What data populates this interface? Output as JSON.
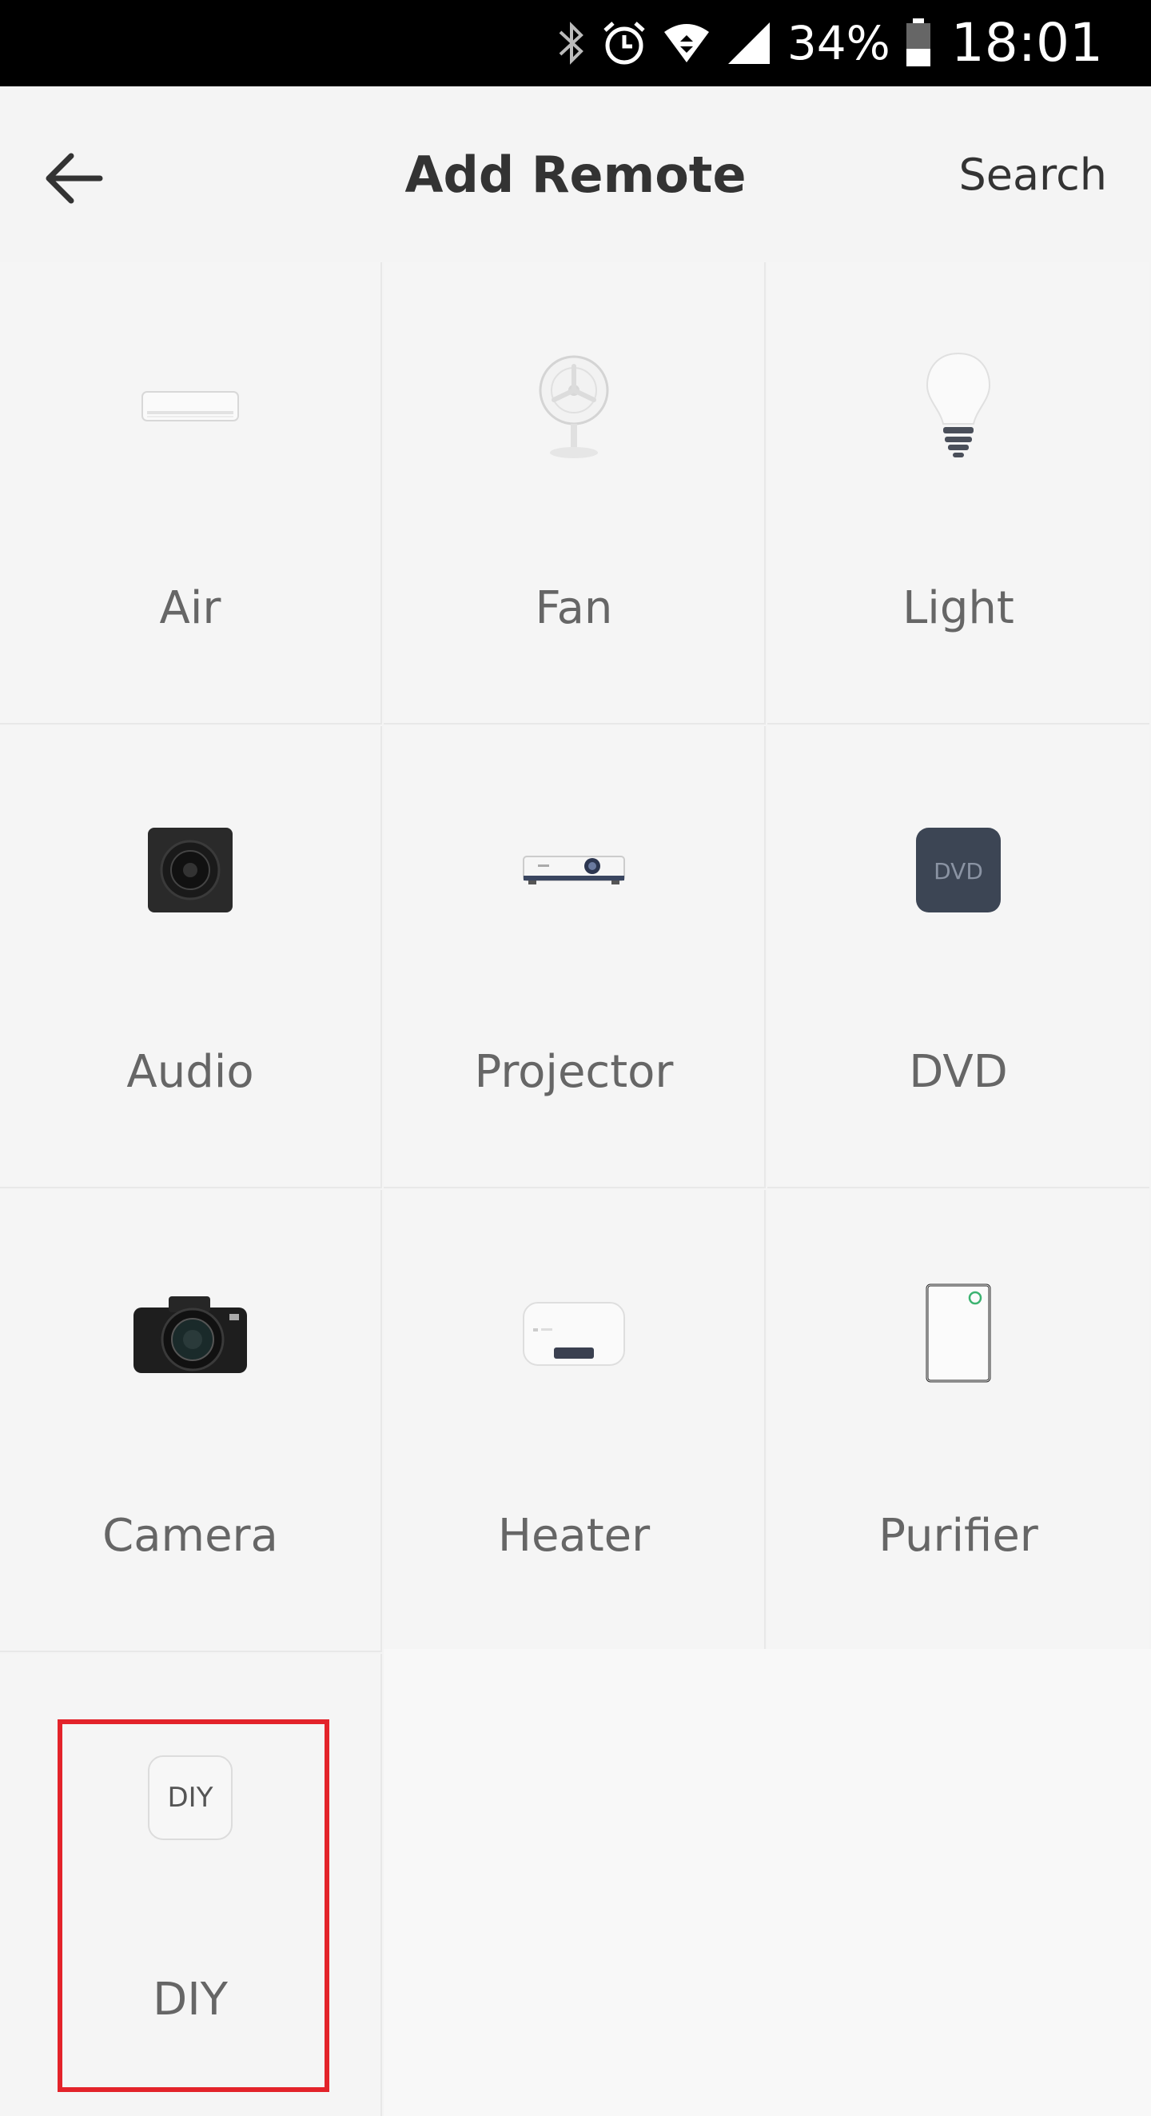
{
  "status_bar": {
    "battery": "34%",
    "time": "18:01"
  },
  "header": {
    "title": "Add Remote",
    "search_label": "Search"
  },
  "devices": [
    {
      "label": "Air",
      "icon": "air-conditioner-icon"
    },
    {
      "label": "Fan",
      "icon": "fan-icon"
    },
    {
      "label": "Light",
      "icon": "light-bulb-icon"
    },
    {
      "label": "Audio",
      "icon": "speaker-icon"
    },
    {
      "label": "Projector",
      "icon": "projector-icon"
    },
    {
      "label": "DVD",
      "icon": "dvd-icon",
      "icon_text": "DVD"
    },
    {
      "label": "Camera",
      "icon": "camera-icon"
    },
    {
      "label": "Heater",
      "icon": "water-heater-icon"
    },
    {
      "label": "Purifier",
      "icon": "air-purifier-icon"
    },
    {
      "label": "DIY",
      "icon": "diy-icon",
      "icon_text": "DIY"
    }
  ],
  "colors": {
    "highlight": "#e3232a",
    "background": "#f4f4f4",
    "label_text": "#666666"
  }
}
